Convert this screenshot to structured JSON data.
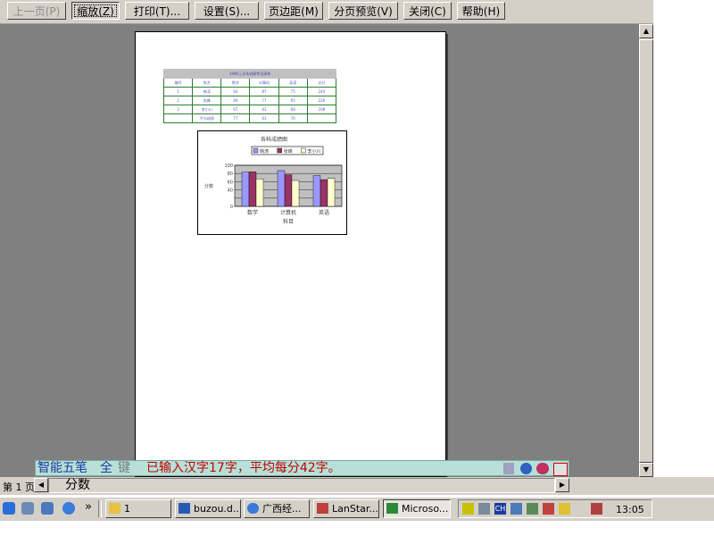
{
  "toolbar": {
    "prev": "上一页(P)",
    "zoom": "缩放(Z)",
    "print": "打印(T)...",
    "setup": "设置(S)...",
    "margins": "页边距(M)",
    "page_break": "分页预览(V)",
    "close": "关闭(C)",
    "help": "帮助(H)"
  },
  "sheet": {
    "title": "1996上半年成绩考试清单",
    "headers": [
      "编号",
      "姓名",
      "数学",
      "计算机",
      "英语",
      "总分"
    ],
    "rows": [
      [
        "1",
        "韩涛",
        "83",
        "87",
        "75",
        "244"
      ],
      [
        "2",
        "张峰",
        "84",
        "77",
        "65",
        "226"
      ],
      [
        "3",
        "李小川",
        "67",
        "63",
        "68",
        "198"
      ],
      [
        "",
        "平均成绩",
        "77",
        "63",
        "70",
        ""
      ]
    ]
  },
  "chart_data": {
    "type": "bar",
    "title": "各科成绩图",
    "xlabel": "科目",
    "ylabel": "分数",
    "categories": [
      "数学",
      "计算机",
      "英语"
    ],
    "series": [
      {
        "name": "韩涛",
        "values": [
          83,
          87,
          75
        ],
        "color": "#9999ff"
      },
      {
        "name": "张峰",
        "values": [
          84,
          77,
          65
        ],
        "color": "#993366"
      },
      {
        "name": "李小川",
        "values": [
          67,
          63,
          68
        ],
        "color": "#ffffcc"
      }
    ],
    "ylim": [
      0,
      100
    ],
    "yticks": [
      "0",
      "40",
      "60",
      "80",
      "100"
    ],
    "plot_bg": "#c0c0c0",
    "grid": true,
    "legend_position": "top"
  },
  "ime": {
    "name": "智能五笔",
    "full": "全",
    "key": "键",
    "message": "已输入汉字17字，平均每分42字。"
  },
  "status": {
    "page": "第 1 页",
    "content": "分数"
  },
  "taskbar": {
    "more": "»",
    "items": [
      "1",
      "buzou.d...",
      "广西经...",
      "LanStar...",
      "Microso..."
    ],
    "tray_lang": "CH",
    "clock": "13:05"
  }
}
